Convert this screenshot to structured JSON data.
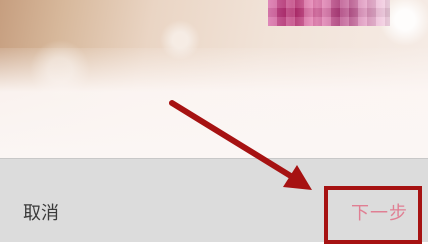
{
  "bottom_bar": {
    "cancel_label": "取消",
    "next_label": "下一步"
  },
  "colors": {
    "annotation_red": "#a61212",
    "next_text": "#e07f93",
    "bar_bg": "#dcdcdc"
  }
}
